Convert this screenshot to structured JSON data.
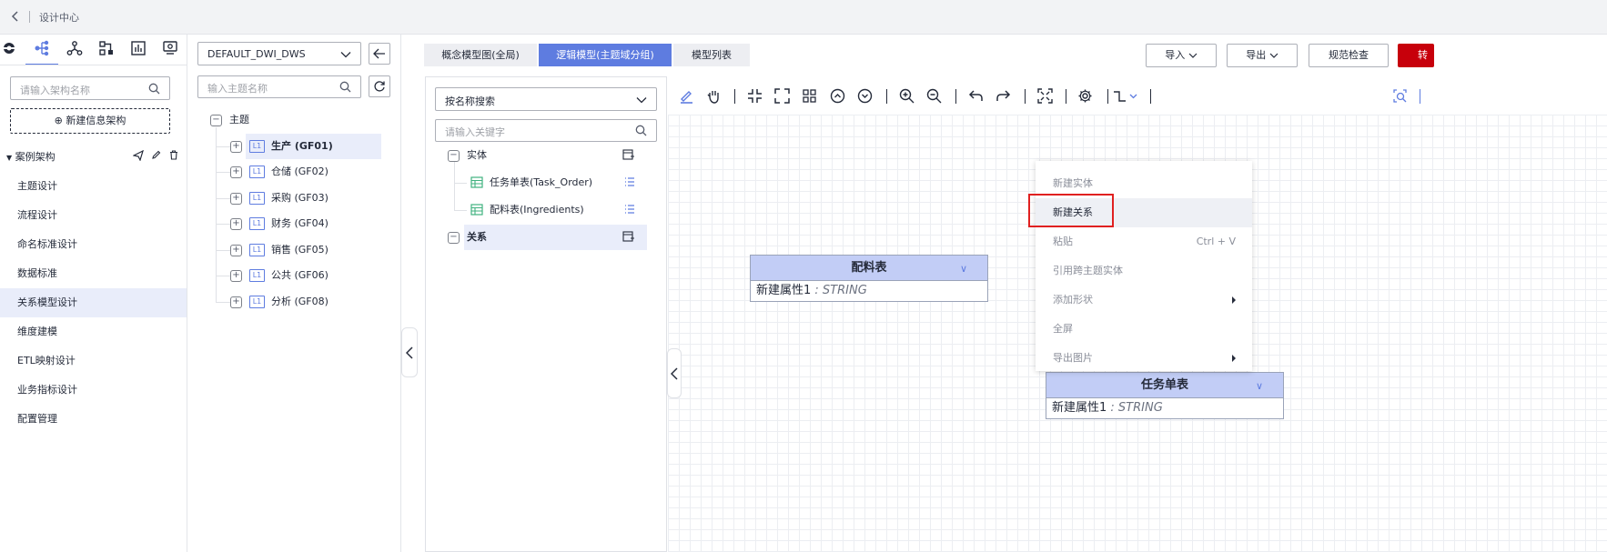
{
  "topbar": {
    "title": "设计中心"
  },
  "left": {
    "search_placeholder": "请输入架构名称",
    "new_arch_label": "⊕ 新建信息架构",
    "arch_name": "案例架构",
    "nav": [
      "主题设计",
      "流程设计",
      "命名标准设计",
      "数据标准",
      "关系模型设计",
      "维度建模",
      "ETL映射设计",
      "业务指标设计",
      "配置管理"
    ],
    "active_nav": "关系模型设计"
  },
  "subject": {
    "workspace": "DEFAULT_DWI_DWS",
    "search_placeholder": "输入主题名称",
    "root_label": "主题",
    "level_badge": "L1",
    "items": [
      "生产 (GF01)",
      "仓储 (GF02)",
      "采购 (GF03)",
      "财务 (GF04)",
      "销售 (GF05)",
      "公共 (GF06)",
      "分析 (GF08)"
    ]
  },
  "tabs": [
    "概念模型图(全局)",
    "逻辑模型(主题域分组)",
    "模型列表"
  ],
  "active_tab": "逻辑模型(主题域分组)",
  "header_buttons": {
    "import": "导入",
    "export": "导出",
    "check": "规范检查",
    "convert": "转"
  },
  "entity_panel": {
    "search_mode": "按名称搜索",
    "keyword_placeholder": "请输入关键字",
    "entity_group": "实体",
    "entities": [
      "任务单表(Task_Order)",
      "配料表(Ingredients)"
    ],
    "relation_group": "关系"
  },
  "canvas": {
    "entities": [
      {
        "name": "配料表",
        "attr_name": "新建属性1",
        "attr_type": " : STRING"
      },
      {
        "name": "任务单表",
        "attr_name": "新建属性1",
        "attr_type": " : STRING"
      }
    ]
  },
  "context_menu": {
    "items": [
      {
        "label": "新建实体"
      },
      {
        "label": "新建关系",
        "highlighted": true
      },
      {
        "label": "粘贴",
        "shortcut": "Ctrl + V"
      },
      {
        "label": "引用跨主题实体"
      },
      {
        "label": "添加形状",
        "submenu": true
      },
      {
        "label": "全屏"
      },
      {
        "label": "导出图片",
        "submenu": true
      }
    ]
  },
  "colors": {
    "accent": "#5e7ce0",
    "danger": "#c7000b",
    "highlight_box": "#e02020",
    "entity_header": "#c2cdf6"
  }
}
